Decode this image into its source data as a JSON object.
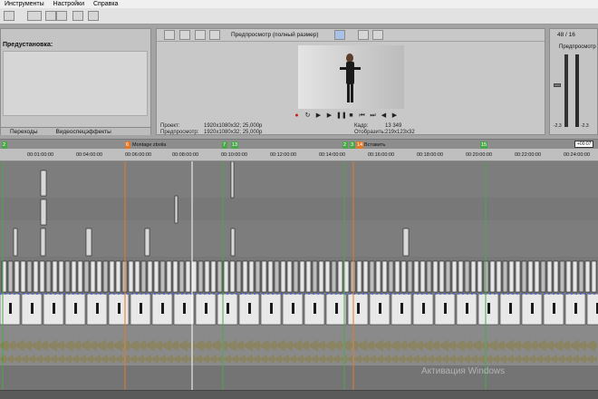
{
  "menu": {
    "items": [
      "Инструменты",
      "Настройки",
      "Справка"
    ]
  },
  "preset_panel": {
    "label": "Предустановка:",
    "tabs": [
      "Переходы",
      "Видеоспецэффекты"
    ]
  },
  "preview": {
    "mode_label": "Предпросмотр (полный размер)",
    "project_label": "Проект:",
    "project_value": "1920x1080x32; 25,000p",
    "preview_label": "Предпросмотр:",
    "preview_value": "1920x1080x32; 25,000p",
    "frame_label": "Кадр:",
    "frame_value": "13 349",
    "display_label": "Отобразить:",
    "display_value": "219x123x32"
  },
  "meter": {
    "count": "48 / 16",
    "label": "Предпросмотр",
    "scale_low": "-2.3",
    "scale_high": "-2.3"
  },
  "timeline": {
    "end_time": "+00:07",
    "marker_labels": {
      "m2": "2",
      "m6": "6",
      "m7": "7",
      "m13": "13",
      "m2b": "2",
      "m3": "3",
      "m14": "14",
      "m15": "15"
    },
    "marker_texts": {
      "region1": "Montage zboila",
      "region2": "Вставить"
    },
    "ruler_ticks": [
      "00:01:00:00",
      "00:04:00:00",
      "00:06:00:00",
      "00:08:00:00",
      "00:10:00:00",
      "00:12:00:00",
      "00:14:00:00",
      "00:16:00:00",
      "00:18:00:00",
      "00:20:00:00",
      "00:22:00:00",
      "00:24:00:00"
    ]
  },
  "watermark": {
    "text": "Активация Windows"
  },
  "colors": {
    "menu_bg": "#f0f0f0",
    "panel_bg": "#c4c4c4",
    "timeline_bg": "#7a7a7a",
    "waveform": "#8a7d3a",
    "marker_green": "#4aa84a",
    "marker_orange": "#e07a2a",
    "record_red": "#cc1a1a",
    "selection_blue": "#3b5bd6"
  }
}
